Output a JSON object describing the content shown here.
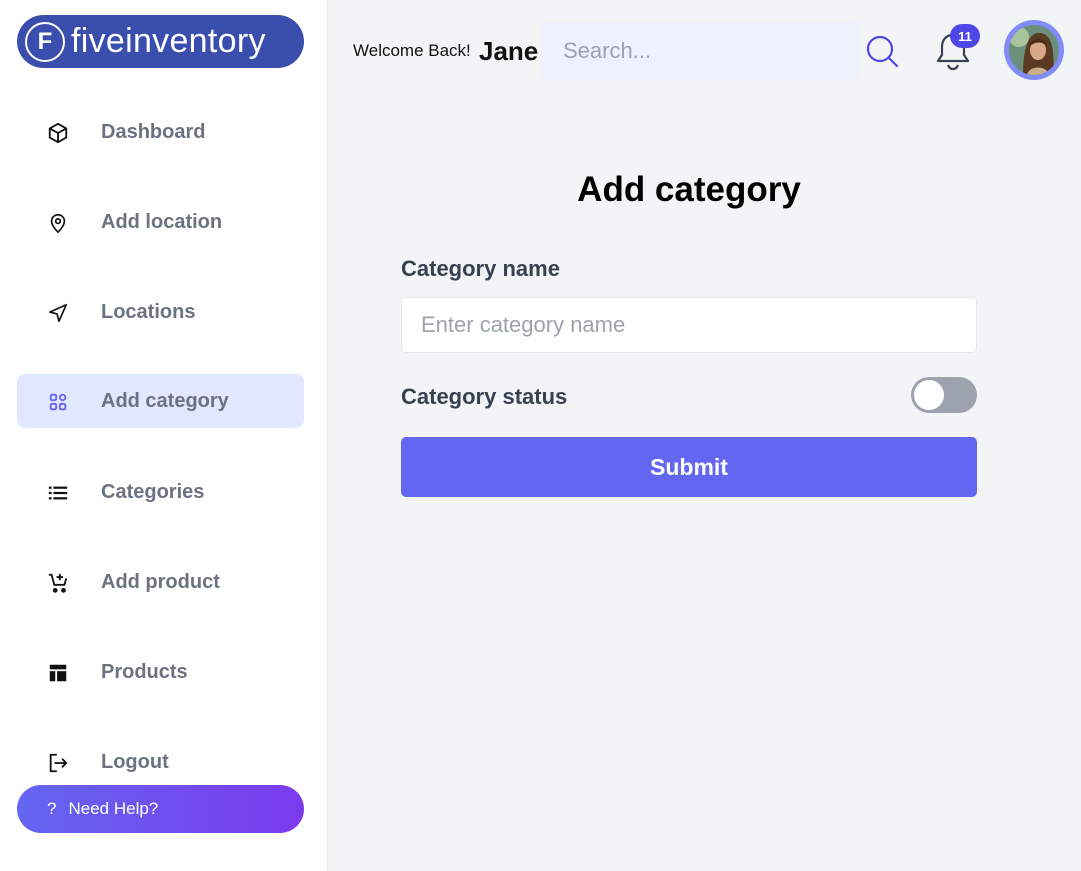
{
  "brand": {
    "name": "fiveinventory",
    "mark": "F",
    "color": "#3a4fad"
  },
  "sidebar": {
    "items": [
      {
        "label": "Dashboard",
        "icon": "cube-icon"
      },
      {
        "label": "Add location",
        "icon": "map-pin-icon"
      },
      {
        "label": "Locations",
        "icon": "navigation-arrow-icon"
      },
      {
        "label": "Add category",
        "icon": "grid-icon",
        "active": true
      },
      {
        "label": "Categories",
        "icon": "list-icon"
      },
      {
        "label": "Add product",
        "icon": "cart-add-icon"
      },
      {
        "label": "Products",
        "icon": "layout-icon"
      },
      {
        "label": "Logout",
        "icon": "logout-icon"
      }
    ],
    "help_label": "Need Help?",
    "help_icon_text": "?"
  },
  "header": {
    "welcome": "Welcome Back!",
    "user_name": "Jane",
    "search_placeholder": "Search...",
    "notification_count": "11"
  },
  "form": {
    "title": "Add category",
    "name_label": "Category name",
    "name_placeholder": "Enter category name",
    "name_value": "",
    "status_label": "Category status",
    "status_on": false,
    "submit_label": "Submit"
  },
  "colors": {
    "accent": "#6366f1",
    "active_nav_bg": "#e0e7ff",
    "toggle_off": "#9ca3af",
    "help_gradient_start": "#6366f1",
    "help_gradient_end": "#7c3aed"
  }
}
